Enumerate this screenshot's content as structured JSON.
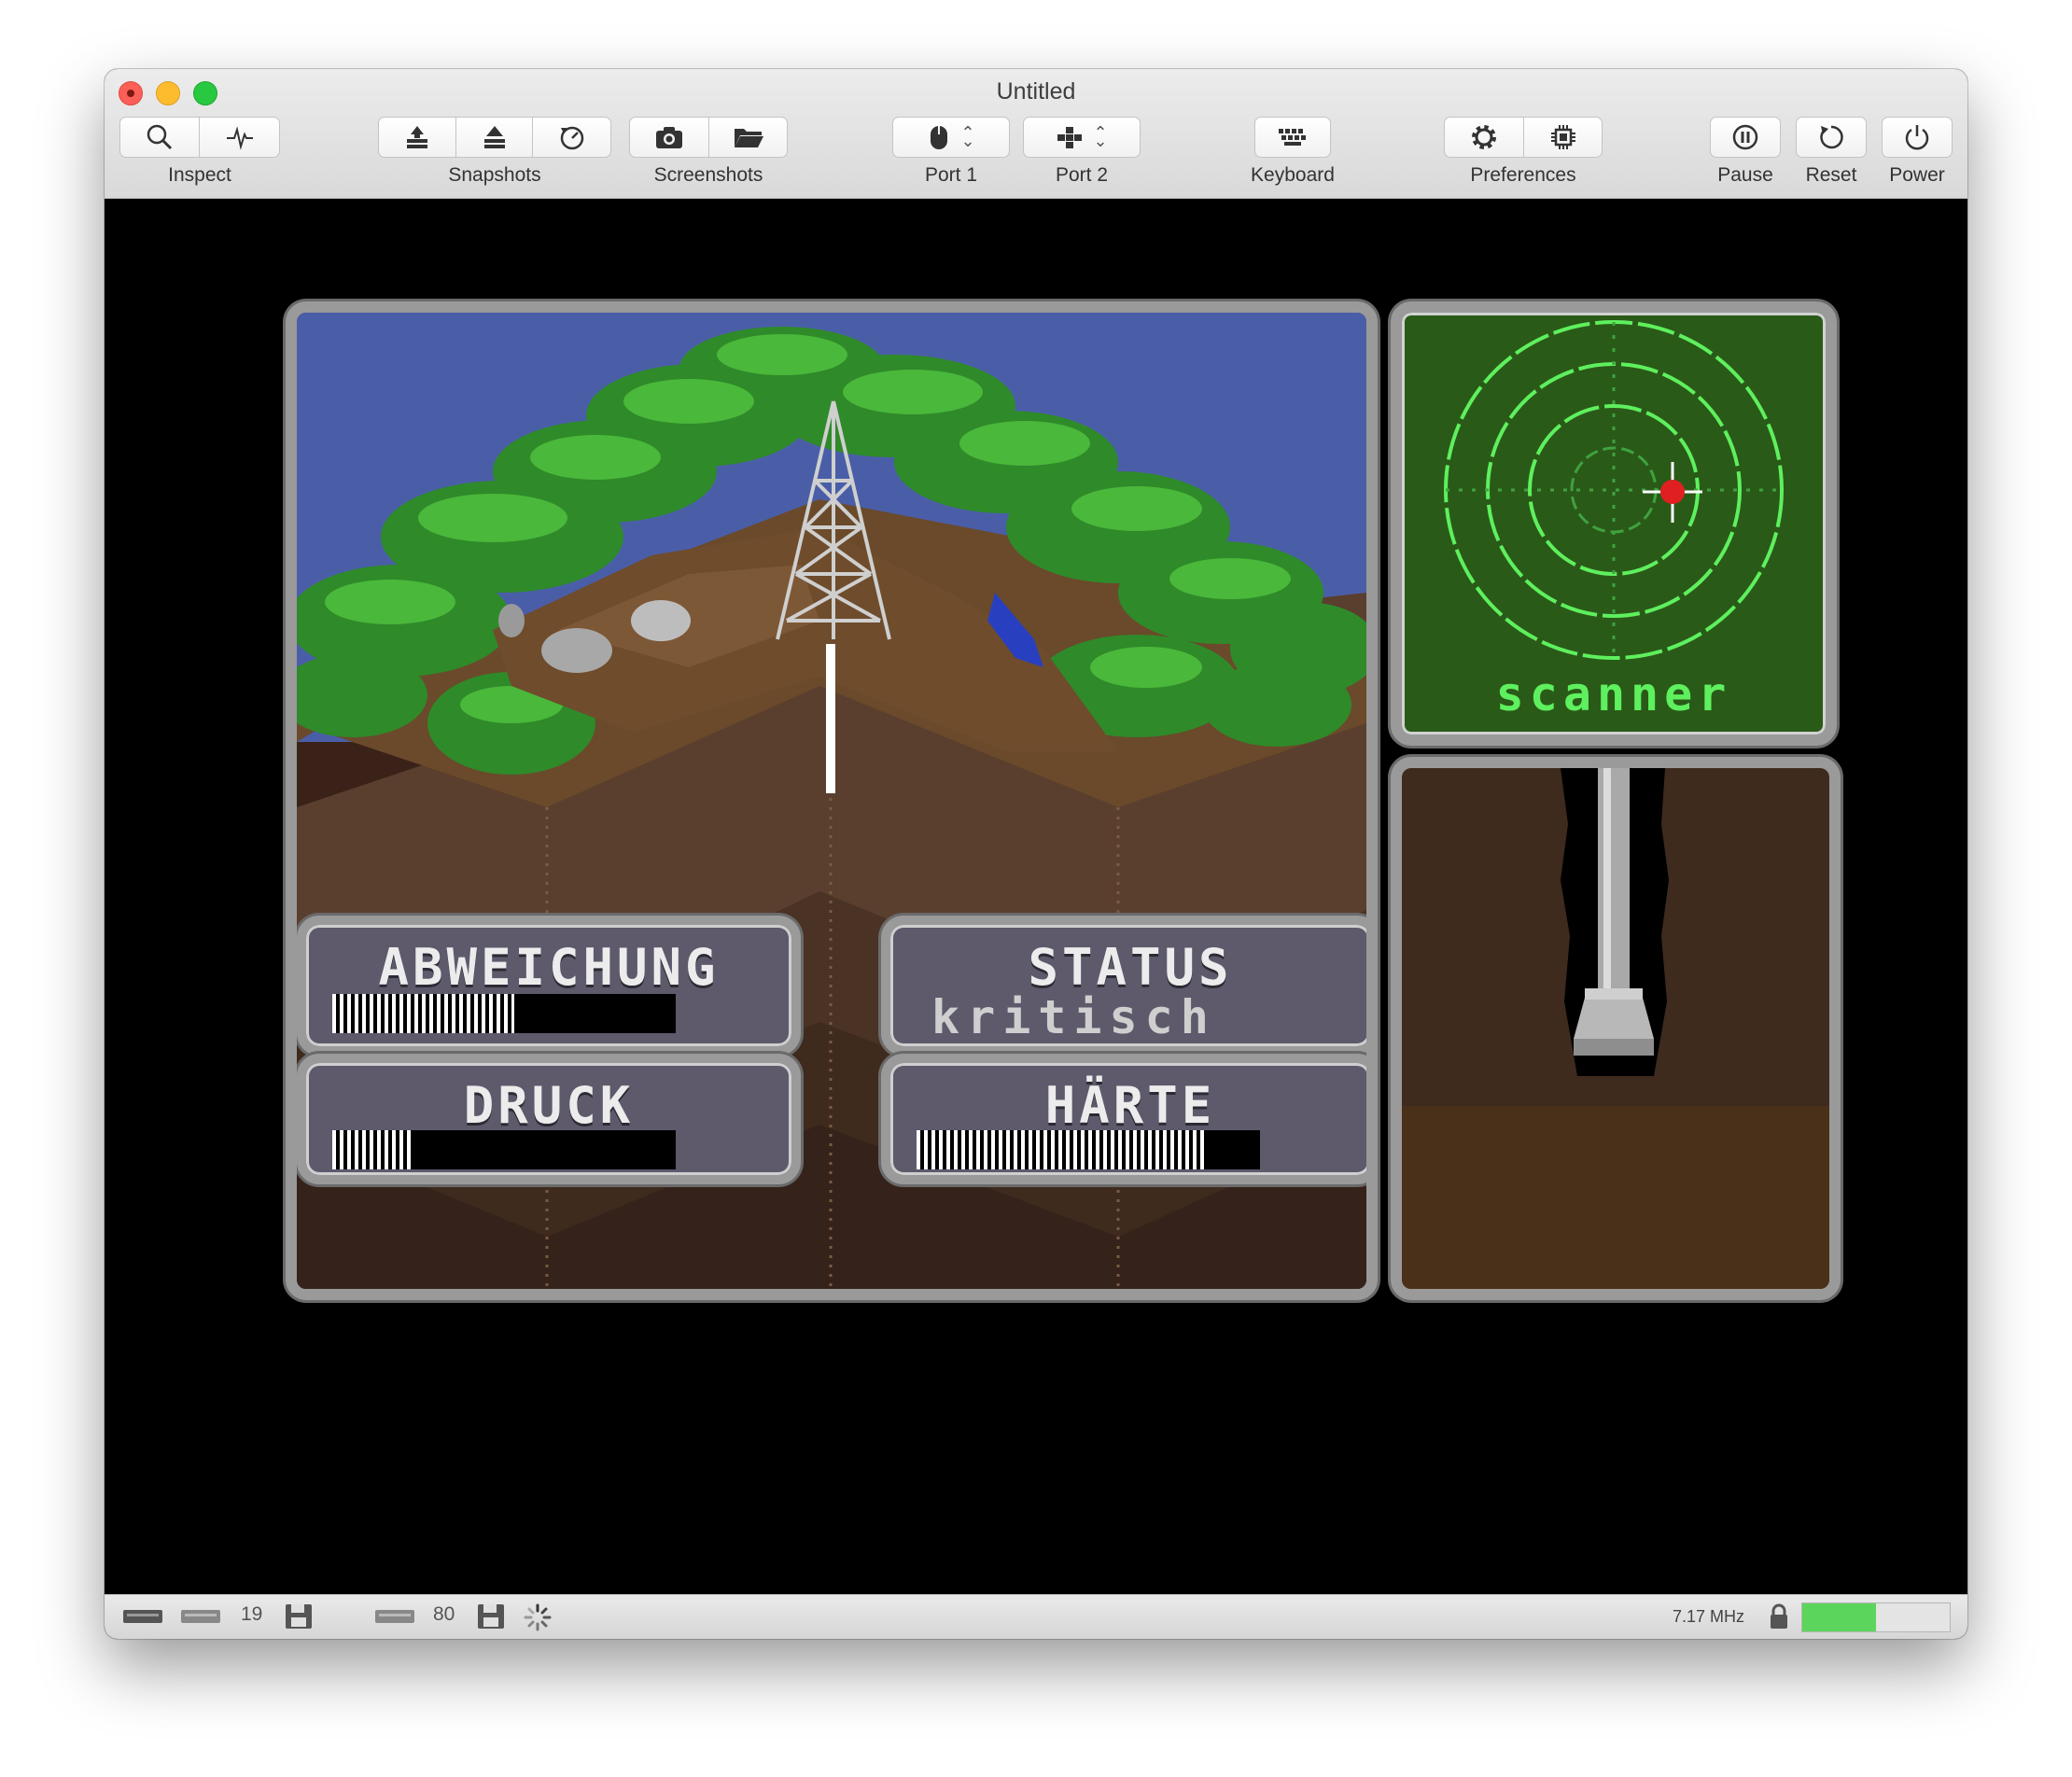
{
  "window": {
    "title": "Untitled"
  },
  "toolbar": {
    "inspect": {
      "label": "Inspect",
      "icons": [
        "magnifier-icon",
        "pulse-icon"
      ]
    },
    "snapshots": {
      "label": "Snapshots",
      "icons": [
        "snapshot-save-icon",
        "snapshot-restore-icon",
        "snapshot-history-icon"
      ]
    },
    "screenshots": {
      "label": "Screenshots",
      "icons": [
        "camera-icon",
        "folder-icon"
      ]
    },
    "port1": {
      "label": "Port 1",
      "icon": "mouse-icon"
    },
    "port2": {
      "label": "Port 2",
      "icon": "joystick-icon"
    },
    "keyboard": {
      "label": "Keyboard",
      "icon": "keyboard-icon"
    },
    "preferences": {
      "label": "Preferences",
      "icons": [
        "gear-icon",
        "chip-icon"
      ]
    },
    "pause": {
      "label": "Pause",
      "icon": "pause-icon"
    },
    "reset": {
      "label": "Reset",
      "icon": "reset-icon"
    },
    "power": {
      "label": "Power",
      "icon": "power-icon"
    }
  },
  "game": {
    "abweichung": {
      "title": "ABWEICHUNG",
      "level": 0.53
    },
    "status": {
      "title": "STATUS",
      "value": "kritisch"
    },
    "druck": {
      "title": "DRUCK",
      "level": 0.23
    },
    "haerte": {
      "title": "HÄRTE",
      "level": 0.84
    },
    "scanner": {
      "label": "scanner"
    }
  },
  "statusbar": {
    "drive1_track": "19",
    "drive2_track": "80",
    "clock": "7.17 MHz",
    "speed_level": 0.5
  },
  "colors": {
    "sky": "#4a5ea8",
    "scanner_bg": "#2a5a18",
    "scanner_ring": "#5ef05e",
    "scanner_target": "#e02020",
    "hud_bg": "#5e5a6c",
    "speed_bar": "#5cd55c"
  }
}
